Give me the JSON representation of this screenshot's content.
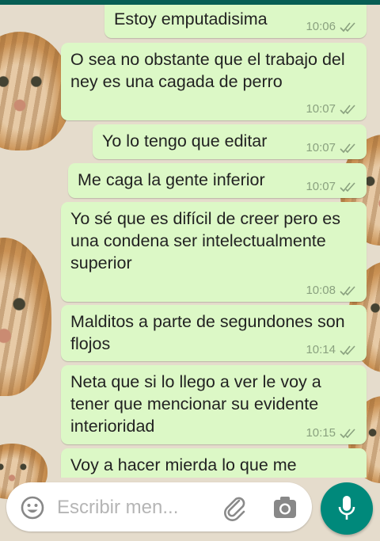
{
  "colors": {
    "outgoing": "#dcf8c6",
    "fab": "#00897b",
    "header": "#075e54",
    "wallpaper": "#e5dccc"
  },
  "messages": [
    {
      "text": "Estoy emputadisima",
      "time": "10:06"
    },
    {
      "text": "O sea no obstante que el trabajo del ney es una cagada de perro",
      "time": "10:07"
    },
    {
      "text": "Yo lo tengo que editar",
      "time": "10:07"
    },
    {
      "text": "Me caga la gente inferior",
      "time": "10:07"
    },
    {
      "text": "Yo sé que es difícil de creer pero es una condena ser intelectualmente superior",
      "time": "10:08"
    },
    {
      "text": "Malditos a parte de segundones son flojos",
      "time": "10:14"
    },
    {
      "text": "Neta que si lo llego a ver le voy a tener que mencionar su evidente interioridad",
      "time": "10:15"
    },
    {
      "text": "Voy a hacer mierda lo que me",
      "time": ""
    }
  ],
  "composer": {
    "placeholder": "Escribir men...",
    "icons": [
      "emoji-icon",
      "attach-icon",
      "camera-icon",
      "mic-icon"
    ]
  }
}
